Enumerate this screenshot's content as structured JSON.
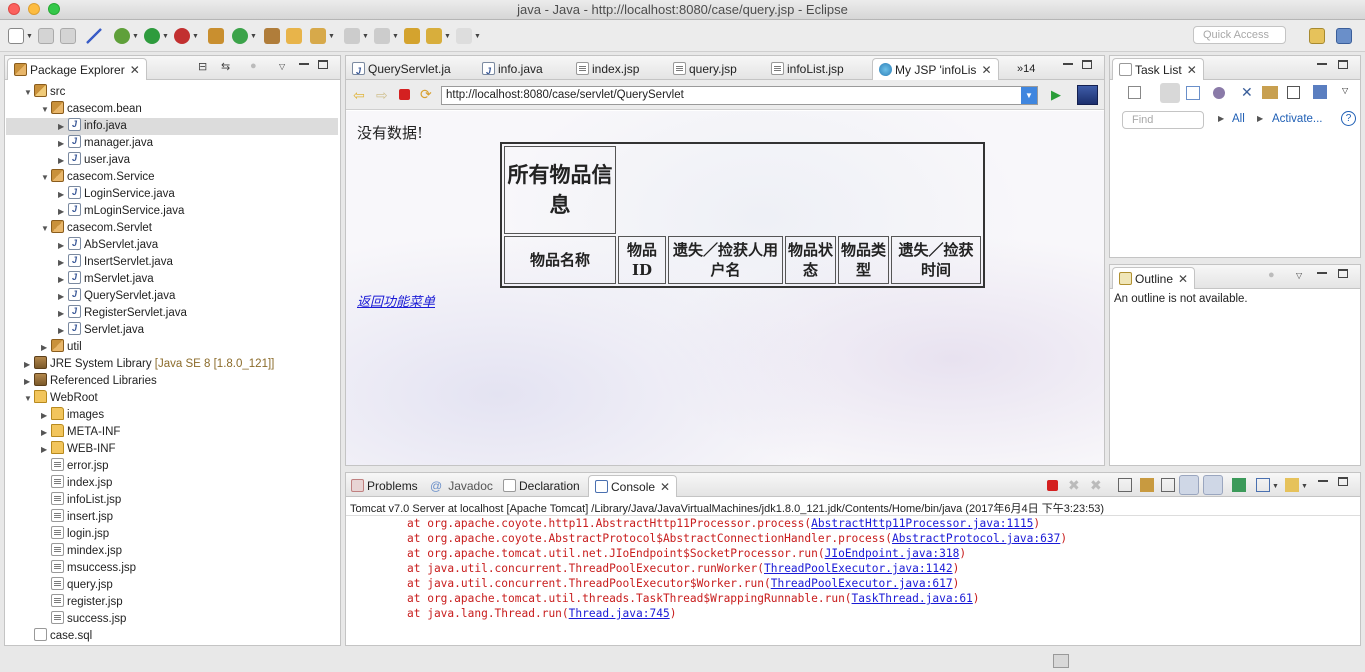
{
  "window": {
    "title": "java - Java - http://localhost:8080/case/query.jsp - Eclipse"
  },
  "toolbar": {
    "quick_access_placeholder": "Quick Access"
  },
  "package_explorer": {
    "tab_label": "Package Explorer",
    "items": [
      {
        "label": "src",
        "icon": "source-folder-icon",
        "expanded": true
      },
      {
        "label": "casecom.bean",
        "icon": "package-icon",
        "expanded": true
      },
      {
        "label": "info.java",
        "icon": "java-file-icon",
        "selected": true
      },
      {
        "label": "manager.java",
        "icon": "java-file-icon"
      },
      {
        "label": "user.java",
        "icon": "java-file-icon"
      },
      {
        "label": "casecom.Service",
        "icon": "package-icon",
        "expanded": true
      },
      {
        "label": "LoginService.java",
        "icon": "java-file-icon"
      },
      {
        "label": "mLoginService.java",
        "icon": "java-file-icon"
      },
      {
        "label": "casecom.Servlet",
        "icon": "package-icon",
        "expanded": true
      },
      {
        "label": "AbServlet.java",
        "icon": "java-file-icon"
      },
      {
        "label": "InsertServlet.java",
        "icon": "java-file-icon"
      },
      {
        "label": "mServlet.java",
        "icon": "java-file-icon"
      },
      {
        "label": "QueryServlet.java",
        "icon": "java-file-icon"
      },
      {
        "label": "RegisterServlet.java",
        "icon": "java-file-icon"
      },
      {
        "label": "Servlet.java",
        "icon": "java-file-icon"
      },
      {
        "label": "util",
        "icon": "package-icon"
      },
      {
        "label": "JRE System Library",
        "suffix": "[Java SE 8 [1.8.0_121]]",
        "icon": "library-icon"
      },
      {
        "label": "Referenced Libraries",
        "icon": "library-icon"
      },
      {
        "label": "WebRoot",
        "icon": "folder-icon",
        "expanded": true
      },
      {
        "label": "images",
        "icon": "folder-icon"
      },
      {
        "label": "META-INF",
        "icon": "folder-icon"
      },
      {
        "label": "WEB-INF",
        "icon": "folder-icon"
      },
      {
        "label": "error.jsp",
        "icon": "jsp-file-icon"
      },
      {
        "label": "index.jsp",
        "icon": "jsp-file-icon"
      },
      {
        "label": "infoList.jsp",
        "icon": "jsp-file-icon"
      },
      {
        "label": "insert.jsp",
        "icon": "jsp-file-icon"
      },
      {
        "label": "login.jsp",
        "icon": "jsp-file-icon"
      },
      {
        "label": "mindex.jsp",
        "icon": "jsp-file-icon"
      },
      {
        "label": "msuccess.jsp",
        "icon": "jsp-file-icon"
      },
      {
        "label": "query.jsp",
        "icon": "jsp-file-icon"
      },
      {
        "label": "register.jsp",
        "icon": "jsp-file-icon"
      },
      {
        "label": "success.jsp",
        "icon": "jsp-file-icon"
      },
      {
        "label": "case.sql",
        "icon": "sql-file-icon"
      }
    ]
  },
  "editor": {
    "tabs": [
      {
        "label": "QueryServlet.ja"
      },
      {
        "label": "info.java"
      },
      {
        "label": "index.jsp"
      },
      {
        "label": "query.jsp"
      },
      {
        "label": "infoList.jsp"
      },
      {
        "label": "My JSP 'infoLis",
        "active": true
      }
    ],
    "overflow_label": "»14",
    "browser": {
      "url": "http://localhost:8080/case/servlet/QueryServlet",
      "no_data": "没有数据!",
      "table_title": "所有物品信息",
      "columns": [
        "物品名称",
        "物品ID",
        "遗失／捡获人用户名",
        "物品状态",
        "物品类型",
        "遗失／捡获时间"
      ],
      "back_link": "返回功能菜单"
    }
  },
  "task_list": {
    "tab_label": "Task List",
    "find_placeholder": "Find",
    "all_label": "All",
    "activate_label": "Activate..."
  },
  "outline": {
    "tab_label": "Outline",
    "message": "An outline is not available."
  },
  "bottom_panel": {
    "tabs": [
      {
        "label": "Problems"
      },
      {
        "label": "Javadoc"
      },
      {
        "label": "Declaration"
      },
      {
        "label": "Console",
        "active": true
      }
    ],
    "console_header": "Tomcat v7.0 Server at localhost [Apache Tomcat] /Library/Java/JavaVirtualMachines/jdk1.8.0_121.jdk/Contents/Home/bin/java (2017年6月4日 下午3:23:53)",
    "lines": [
      {
        "text": "at org.apache.coyote.http11.AbstractHttp11Processor.process(",
        "link": "AbstractHttp11Processor.java:1115",
        "tail": ")"
      },
      {
        "text": "at org.apache.coyote.AbstractProtocol$AbstractConnectionHandler.process(",
        "link": "AbstractProtocol.java:637",
        "tail": ")"
      },
      {
        "text": "at org.apache.tomcat.util.net.JIoEndpoint$SocketProcessor.run(",
        "link": "JIoEndpoint.java:318",
        "tail": ")"
      },
      {
        "text": "at java.util.concurrent.ThreadPoolExecutor.runWorker(",
        "link": "ThreadPoolExecutor.java:1142",
        "tail": ")"
      },
      {
        "text": "at java.util.concurrent.ThreadPoolExecutor$Worker.run(",
        "link": "ThreadPoolExecutor.java:617",
        "tail": ")"
      },
      {
        "text": "at org.apache.tomcat.util.threads.TaskThread$WrappingRunnable.run(",
        "link": "TaskThread.java:61",
        "tail": ")"
      },
      {
        "text": "at java.lang.Thread.run(",
        "link": "Thread.java:745",
        "tail": ")"
      }
    ]
  },
  "colors": {
    "accent": "#3f86df",
    "console_error": "#c81d1d",
    "console_link": "#1a1ad6"
  }
}
